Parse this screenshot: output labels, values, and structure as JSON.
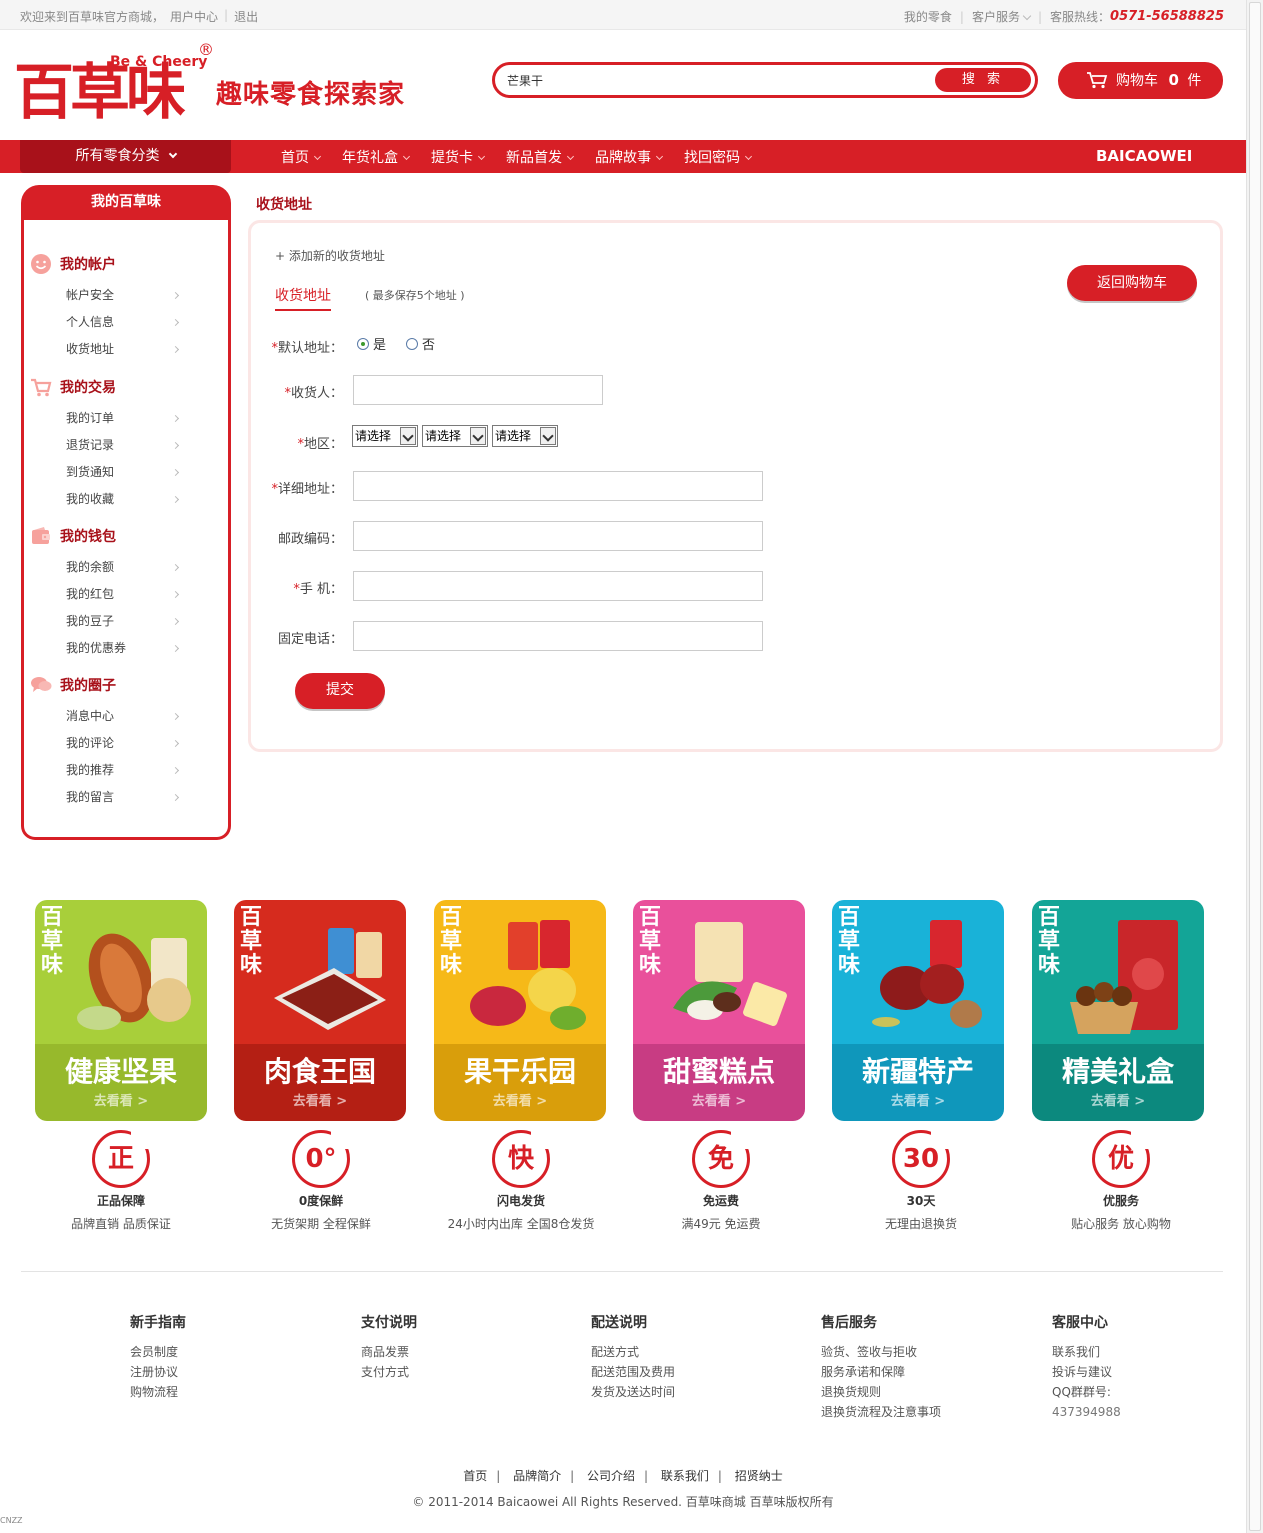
{
  "topbar": {
    "welcome": "欢迎来到百草味官方商城，",
    "user_center": "用户中心",
    "logout": "退出",
    "my_snacks": "我的零食",
    "customer_service": "客户服务",
    "hotline_label": "客服热线：",
    "hotline": "0571-56588825"
  },
  "header": {
    "logo_cn": "百草味",
    "logo_en": "Be & Cheery",
    "logo_reg": "®",
    "slogan": "趣味零食探索家",
    "search_value": "芒果干",
    "search_button": "搜 索",
    "cart_label": "购物车",
    "cart_count": "0",
    "cart_unit": "件"
  },
  "nav": {
    "all_categories": "所有零食分类",
    "items": [
      "首页",
      "年货礼盒",
      "提货卡",
      "新品首发",
      "品牌故事",
      "找回密码"
    ],
    "brand": "BAICAOWEI"
  },
  "sidebar": {
    "title": "我的百草味",
    "groups": [
      {
        "title": "我的帐户",
        "icon": "smiley-icon",
        "items": [
          "帐户安全",
          "个人信息",
          "收货地址"
        ]
      },
      {
        "title": "我的交易",
        "icon": "shopping-cart-icon",
        "items": [
          "我的订单",
          "退货记录",
          "到货通知",
          "我的收藏"
        ]
      },
      {
        "title": "我的钱包",
        "icon": "wallet-icon",
        "items": [
          "我的余额",
          "我的红包",
          "我的豆子",
          "我的优惠券"
        ]
      },
      {
        "title": "我的圈子",
        "icon": "chat-bubbles-icon",
        "items": [
          "消息中心",
          "我的评论",
          "我的推荐",
          "我的留言"
        ]
      }
    ]
  },
  "main": {
    "title": "收货地址",
    "add_new": "+ 添加新的收货地址",
    "tab": "收货地址",
    "tab_note": "( 最多保存5个地址 )",
    "back_to_cart": "返回购物车",
    "form": {
      "default_label": "默认地址：",
      "yes": "是",
      "no": "否",
      "receiver_label": "收货人：",
      "region_label": "地区：",
      "region_placeholder": "请选择",
      "address_label": "详细地址：",
      "zip_label": "邮政编码：",
      "mobile_label": "手 机：",
      "phone_label": "固定电话：",
      "required_mark": "*",
      "submit": "提交"
    }
  },
  "categories": [
    {
      "name": "健康坚果",
      "go": "去看看 >",
      "top": "#a8cf3a",
      "bottom": "#97b92c"
    },
    {
      "name": "肉食王国",
      "go": "去看看 >",
      "top": "#d62b1e",
      "bottom": "#b41f14"
    },
    {
      "name": "果干乐园",
      "go": "去看看 >",
      "top": "#f6b918",
      "bottom": "#d99e0b"
    },
    {
      "name": "甜蜜糕点",
      "go": "去看看 >",
      "top": "#e9509b",
      "bottom": "#c83c83"
    },
    {
      "name": "新疆特产",
      "go": "去看看 >",
      "top": "#19b2d8",
      "bottom": "#0f97bb"
    },
    {
      "name": "精美礼盒",
      "go": "去看看 >",
      "top": "#13a597",
      "bottom": "#0c897e"
    }
  ],
  "tile_logo": "百草味",
  "badges": [
    {
      "icon": "正",
      "title": "正品保障",
      "sub": "品牌直销 品质保证"
    },
    {
      "icon": "0°",
      "title": "0度保鲜",
      "sub": "无货架期 全程保鲜"
    },
    {
      "icon": "快",
      "title": "闪电发货",
      "sub": "24小时内出库 全国8仓发货"
    },
    {
      "icon": "免",
      "title": "免运费",
      "sub": "满49元 免运费"
    },
    {
      "icon": "30",
      "title": "30天",
      "sub": "无理由退换货"
    },
    {
      "icon": "优",
      "title": "优服务",
      "sub": "贴心服务 放心购物"
    }
  ],
  "footer": {
    "columns": [
      {
        "title": "新手指南",
        "links": [
          "会员制度",
          "注册协议",
          "购物流程"
        ]
      },
      {
        "title": "支付说明",
        "links": [
          "商品发票",
          "支付方式"
        ]
      },
      {
        "title": "配送说明",
        "links": [
          "配送方式",
          "配送范围及费用",
          "发货及送达时间"
        ]
      },
      {
        "title": "售后服务",
        "links": [
          "验货、签收与拒收",
          "服务承诺和保障",
          "退换货规则",
          "退换货流程及注意事项"
        ]
      },
      {
        "title": "客服中心",
        "links": [
          "联系我们",
          "投诉与建议",
          "QQ群群号:",
          "437394988"
        ]
      }
    ],
    "bottom_links": [
      "首页",
      "品牌简介",
      "公司介绍",
      "联系我们",
      "招贤纳士"
    ],
    "copyright": "© 2011-2014 Baicaowei All Rights Reserved. 百草味商城  百草味版权所有",
    "corner": "CNZZ"
  }
}
